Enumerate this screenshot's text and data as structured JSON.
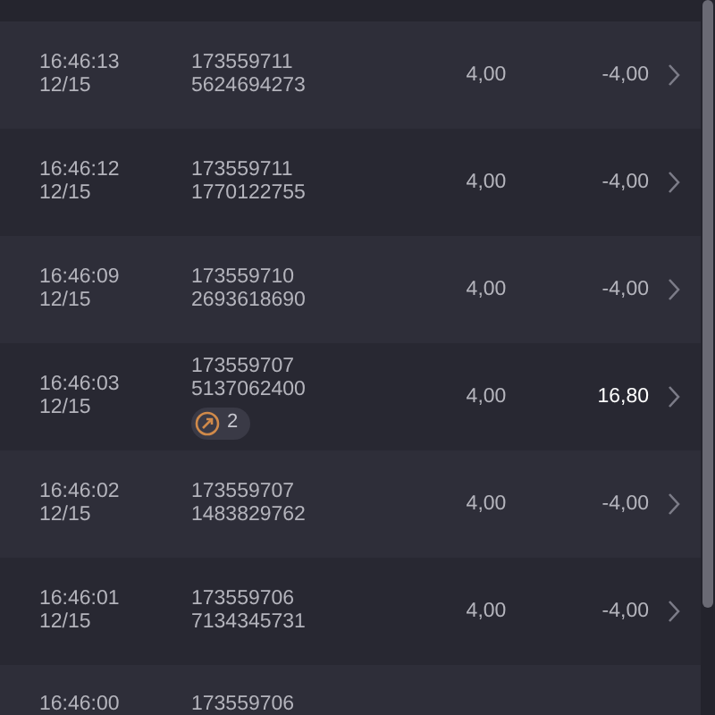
{
  "rows": [
    {
      "time": "16:46:13",
      "date": "12/15",
      "id_line1": "173559711",
      "id_line2": "5624694273",
      "stake": "4,00",
      "result": "-4,00",
      "win": false
    },
    {
      "time": "16:46:12",
      "date": "12/15",
      "id_line1": "173559711",
      "id_line2": "1770122755",
      "stake": "4,00",
      "result": "-4,00",
      "win": false
    },
    {
      "time": "16:46:09",
      "date": "12/15",
      "id_line1": "173559710",
      "id_line2": "2693618690",
      "stake": "4,00",
      "result": "-4,00",
      "win": false
    },
    {
      "time": "16:46:03",
      "date": "12/15",
      "id_line1": "173559707",
      "id_line2": "5137062400",
      "badge": "2",
      "stake": "4,00",
      "result": "16,80",
      "win": true
    },
    {
      "time": "16:46:02",
      "date": "12/15",
      "id_line1": "173559707",
      "id_line2": "1483829762",
      "stake": "4,00",
      "result": "-4,00",
      "win": false
    },
    {
      "time": "16:46:01",
      "date": "12/15",
      "id_line1": "173559706",
      "id_line2": "7134345731",
      "stake": "4,00",
      "result": "-4,00",
      "win": false
    },
    {
      "time": "16:46:00",
      "id_line1": "173559706"
    }
  ]
}
